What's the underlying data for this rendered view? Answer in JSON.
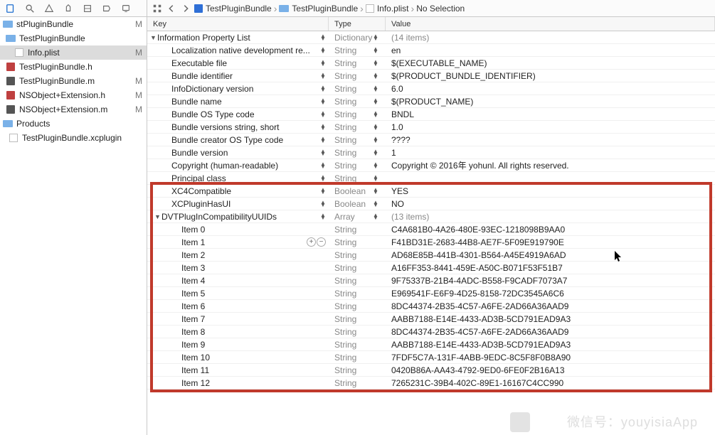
{
  "sidebar": {
    "items": [
      {
        "label": "stPluginBundle",
        "status": "M",
        "icon": "folder",
        "indent": 0
      },
      {
        "label": "TestPluginBundle",
        "status": "",
        "icon": "folder",
        "indent": 4
      },
      {
        "label": "Info.plist",
        "status": "M",
        "icon": "plist",
        "indent": 16,
        "selected": true
      },
      {
        "label": "TestPluginBundle.h",
        "status": "",
        "icon": "h",
        "indent": 4
      },
      {
        "label": "TestPluginBundle.m",
        "status": "M",
        "icon": "m",
        "indent": 4
      },
      {
        "label": "NSObject+Extension.h",
        "status": "M",
        "icon": "h",
        "indent": 4
      },
      {
        "label": "NSObject+Extension.m",
        "status": "M",
        "icon": "m",
        "indent": 4
      },
      {
        "label": "Products",
        "status": "",
        "icon": "folder",
        "indent": 0
      },
      {
        "label": "TestPluginBundle.xcplugin",
        "status": "",
        "icon": "box",
        "indent": 8
      }
    ]
  },
  "jumpbar": {
    "crumbs": [
      {
        "label": "TestPluginBundle",
        "icon": "project"
      },
      {
        "label": "TestPluginBundle",
        "icon": "folder"
      },
      {
        "label": "Info.plist",
        "icon": "plist"
      },
      {
        "label": "No Selection",
        "icon": ""
      }
    ]
  },
  "plist": {
    "headers": {
      "key": "Key",
      "type": "Type",
      "value": "Value"
    },
    "rows": [
      {
        "key": "Information Property List",
        "type": "Dictionary",
        "value": "(14 items)",
        "indent": 0,
        "disclosure": "open",
        "stepper": true,
        "mutedType": true,
        "mutedValue": true
      },
      {
        "key": "Localization native development re...",
        "type": "String",
        "value": "en",
        "indent": 20,
        "stepper": true,
        "mutedType": true
      },
      {
        "key": "Executable file",
        "type": "String",
        "value": "$(EXECUTABLE_NAME)",
        "indent": 20,
        "stepper": true,
        "mutedType": true
      },
      {
        "key": "Bundle identifier",
        "type": "String",
        "value": "$(PRODUCT_BUNDLE_IDENTIFIER)",
        "indent": 20,
        "stepper": true,
        "mutedType": true
      },
      {
        "key": "InfoDictionary version",
        "type": "String",
        "value": "6.0",
        "indent": 20,
        "stepper": true,
        "mutedType": true
      },
      {
        "key": "Bundle name",
        "type": "String",
        "value": "$(PRODUCT_NAME)",
        "indent": 20,
        "stepper": true,
        "mutedType": true
      },
      {
        "key": "Bundle OS Type code",
        "type": "String",
        "value": "BNDL",
        "indent": 20,
        "stepper": true,
        "mutedType": true
      },
      {
        "key": "Bundle versions string, short",
        "type": "String",
        "value": "1.0",
        "indent": 20,
        "stepper": true,
        "mutedType": true
      },
      {
        "key": "Bundle creator OS Type code",
        "type": "String",
        "value": "????",
        "indent": 20,
        "stepper": true,
        "mutedType": true
      },
      {
        "key": "Bundle version",
        "type": "String",
        "value": "1",
        "indent": 20,
        "stepper": true,
        "mutedType": true
      },
      {
        "key": "Copyright (human-readable)",
        "type": "String",
        "value": "Copyright © 2016年 yohunl. All rights reserved.",
        "indent": 20,
        "stepper": true,
        "mutedType": true
      },
      {
        "key": "Principal class",
        "type": "String",
        "value": "",
        "indent": 20,
        "stepper": true,
        "mutedType": true
      },
      {
        "key": "XC4Compatible",
        "type": "Boolean",
        "value": "YES",
        "indent": 20,
        "stepper": true
      },
      {
        "key": "XCPluginHasUI",
        "type": "Boolean",
        "value": "NO",
        "indent": 20,
        "stepper": true
      },
      {
        "key": "DVTPlugInCompatibilityUUIDs",
        "type": "Array",
        "value": "(13 items)",
        "indent": 6,
        "disclosure": "open",
        "stepper": true,
        "mutedValue": true
      },
      {
        "key": "Item 0",
        "type": "String",
        "value": "C4A681B0-4A26-480E-93EC-1218098B9AA0",
        "indent": 34
      },
      {
        "key": "Item 1",
        "type": "String",
        "value": "F41BD31E-2683-44B8-AE7F-5F09E919790E",
        "indent": 34,
        "plusminus": true
      },
      {
        "key": "Item 2",
        "type": "String",
        "value": "AD68E85B-441B-4301-B564-A45E4919A6AD",
        "indent": 34
      },
      {
        "key": "Item 3",
        "type": "String",
        "value": "A16FF353-8441-459E-A50C-B071F53F51B7",
        "indent": 34
      },
      {
        "key": "Item 4",
        "type": "String",
        "value": "9F75337B-21B4-4ADC-B558-F9CADF7073A7",
        "indent": 34
      },
      {
        "key": "Item 5",
        "type": "String",
        "value": "E969541F-E6F9-4D25-8158-72DC3545A6C6",
        "indent": 34
      },
      {
        "key": "Item 6",
        "type": "String",
        "value": "8DC44374-2B35-4C57-A6FE-2AD66A36AAD9",
        "indent": 34
      },
      {
        "key": "Item 7",
        "type": "String",
        "value": "AABB7188-E14E-4433-AD3B-5CD791EAD9A3",
        "indent": 34
      },
      {
        "key": "Item 8",
        "type": "String",
        "value": "8DC44374-2B35-4C57-A6FE-2AD66A36AAD9",
        "indent": 34
      },
      {
        "key": "Item 9",
        "type": "String",
        "value": "AABB7188-E14E-4433-AD3B-5CD791EAD9A3",
        "indent": 34
      },
      {
        "key": "Item 10",
        "type": "String",
        "value": "7FDF5C7A-131F-4ABB-9EDC-8C5F8F0B8A90",
        "indent": 34
      },
      {
        "key": "Item 11",
        "type": "String",
        "value": "0420B86A-AA43-4792-9ED0-6FE0F2B16A13",
        "indent": 34
      },
      {
        "key": "Item 12",
        "type": "String",
        "value": "7265231C-39B4-402C-89E1-16167C4CC990",
        "indent": 34
      }
    ],
    "highlightStart": 12,
    "highlightEnd": 28
  },
  "watermark": "微信号：youyisiaApp"
}
